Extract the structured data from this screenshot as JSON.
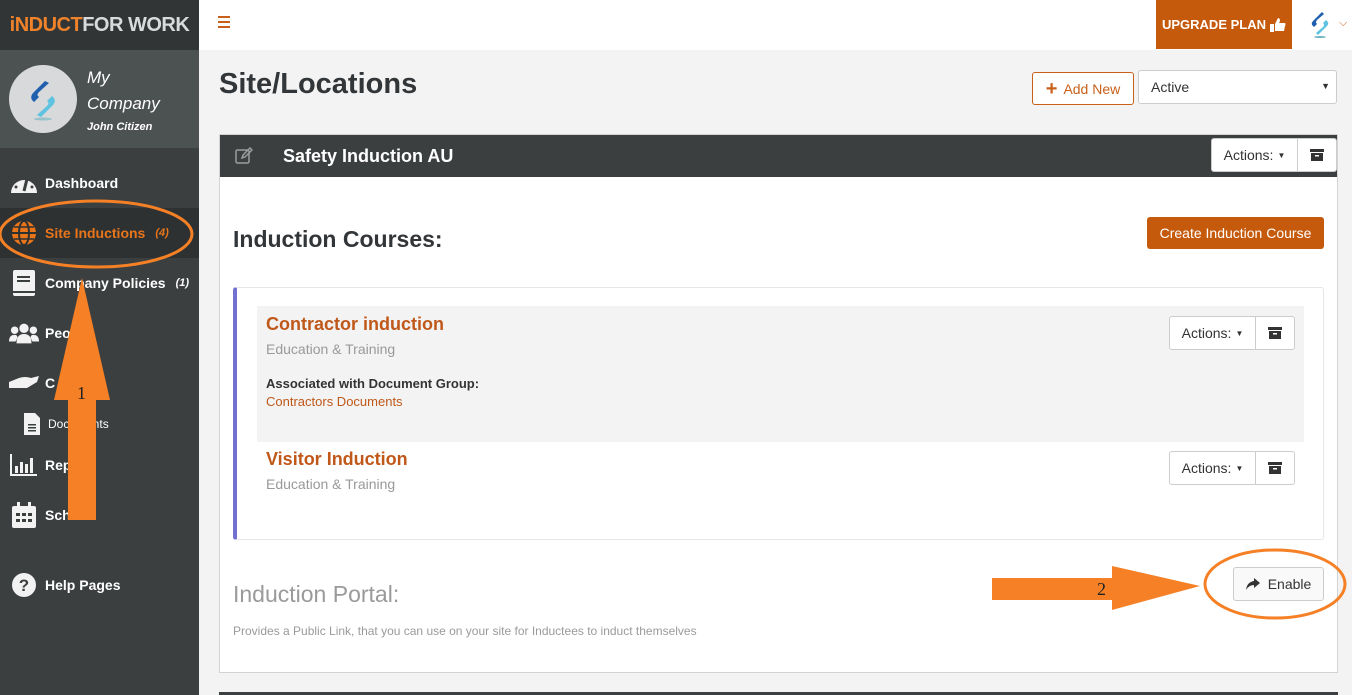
{
  "brand": {
    "part1": "iNDUCT",
    "part2": "FOR WORK"
  },
  "profile": {
    "company": "My Company",
    "user": "John Citizen"
  },
  "sidebar": {
    "items": [
      {
        "label": "Dashboard",
        "icon": "dashboard-gauge-icon",
        "count": ""
      },
      {
        "label": "Site Inductions",
        "icon": "globe-icon",
        "count": "(4)",
        "active": true
      },
      {
        "label": "Company Policies",
        "icon": "book-icon",
        "count": "(1)"
      },
      {
        "label": "People",
        "icon": "users-icon",
        "count": ""
      },
      {
        "label": "Contractors",
        "icon": "hand-icon",
        "count": ""
      },
      {
        "label": "Documents",
        "icon": "file-icon",
        "count": "",
        "sub": true
      },
      {
        "label": "Reports",
        "icon": "bar-chart-icon",
        "count": ""
      },
      {
        "label": "Schedules",
        "icon": "calendar-icon",
        "count": ""
      },
      {
        "label": "Help Pages",
        "icon": "question-circle-icon",
        "count": ""
      }
    ],
    "visible_labels": {
      "people": "Peo",
      "contractors": "C",
      "documents": "Documents",
      "reports": "Rep",
      "schedules": "Sche"
    }
  },
  "topbar": {
    "upgrade_label": "UPGRADE PLAN"
  },
  "page": {
    "title": "Site/Locations",
    "add_new_label": "Add New",
    "status_filter": {
      "selected": "Active"
    }
  },
  "site": {
    "name": "Safety Induction AU",
    "actions_label": "Actions:",
    "courses_heading": "Induction Courses:",
    "create_course_label": "Create Induction Course",
    "courses": [
      {
        "name": "Contractor induction",
        "category": "Education & Training",
        "assoc_label": "Associated with Document Group:",
        "assoc_group": "Contractors Documents",
        "actions_label": "Actions:"
      },
      {
        "name": "Visitor Induction",
        "category": "Education & Training",
        "actions_label": "Actions:"
      }
    ],
    "portal": {
      "title": "Induction Portal:",
      "description": "Provides a Public Link, that you can use on your site for Inductees to induct themselves",
      "enable_label": "Enable"
    }
  },
  "annotations": {
    "step1": "1",
    "step2": "2",
    "color": "#f58025"
  },
  "colors": {
    "accent": "#c65a0c",
    "sidebar": "#3b3f40",
    "course_bar": "#7370d1"
  }
}
